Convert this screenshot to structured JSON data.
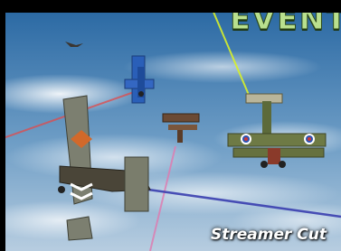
{
  "header": {
    "title": "EVENT"
  },
  "caption": {
    "text": "Streamer Cut"
  },
  "scene": {
    "description_icons": [
      "biplane-icon"
    ],
    "colors": {
      "sky_top": "#2f6fa8",
      "sky_bottom": "#a9c4dc",
      "streamer_yellow": "#d8f02a",
      "streamer_red": "#e24a4a",
      "streamer_pink": "#e07ab0",
      "streamer_blue": "#3a3fb0",
      "title_green": "#b9e08e"
    }
  }
}
